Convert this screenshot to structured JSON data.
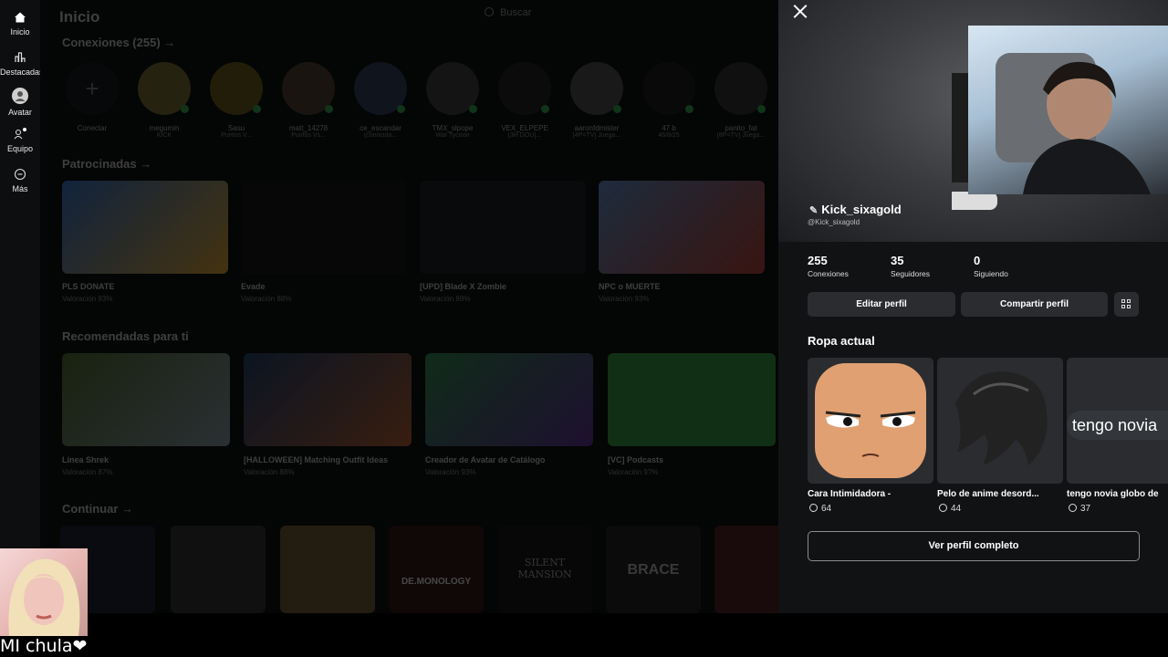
{
  "nav": {
    "items": [
      {
        "label": "Inicio",
        "icon": "home-icon"
      },
      {
        "label": "Destacadas",
        "icon": "chart-icon"
      },
      {
        "label": "Avatar",
        "icon": "avatar-icon"
      },
      {
        "label": "Equipo",
        "icon": "team-icon"
      },
      {
        "label": "Más",
        "icon": "more-icon"
      }
    ]
  },
  "home": {
    "title": "Inicio",
    "search_placeholder": "Buscar",
    "connections_title": "Conexiones (255) →",
    "connections": [
      {
        "name": "Conectar",
        "status": ""
      },
      {
        "name": "megumin",
        "status": "KICK"
      },
      {
        "name": "Sasu",
        "status": "Puntos V..."
      },
      {
        "name": "matt_14278",
        "status": "Puntos Vs..."
      },
      {
        "name": "ce_escandar",
        "status": "(conocida..."
      },
      {
        "name": "TMX_slpope",
        "status": "War Tycoon"
      },
      {
        "name": "VEX_ELPEPE",
        "status": "[3H DOU]..."
      },
      {
        "name": "aaronfdmister",
        "status": "[4P=TV] Juega..."
      },
      {
        "name": "47 b",
        "status": "46/8/25"
      },
      {
        "name": "panito_fat",
        "status": "[8P=TV] Juega..."
      }
    ],
    "sponsored_title": "Patrocinadas →",
    "sponsored": [
      {
        "name": "PLS DONATE",
        "rating": "Valoración 93%"
      },
      {
        "name": "Evade",
        "rating": "Valoración 88%"
      },
      {
        "name": "[UPD] Blade X Zombie",
        "rating": "Valoración 89%"
      },
      {
        "name": "NPC o MUERTE",
        "rating": "Valoración 93%"
      }
    ],
    "recommended_title": "Recomendadas para ti",
    "recommended": [
      {
        "name": "Línea Shrek",
        "rating": "Valoración 87%"
      },
      {
        "name": "[HALLOWEEN] Matching Outfit Ideas",
        "rating": "Valoración 88%"
      },
      {
        "name": "Creador de Avatar de Catálogo",
        "rating": "Valoración 93%"
      },
      {
        "name": "[VC] Podcasts",
        "rating": "Valoración 9?%"
      }
    ],
    "continue_title": "Continuar →",
    "continue_tiles": [
      "",
      "",
      "",
      "DE.MONOLOGY",
      "SILENT MANSION",
      "BRACE",
      ""
    ]
  },
  "profile": {
    "display_name": "Kick_sixagold",
    "handle": "@Kick_sixagold",
    "stats": [
      {
        "value": "255",
        "label": "Conexiones"
      },
      {
        "value": "35",
        "label": "Seguidores"
      },
      {
        "value": "0",
        "label": "Siguiendo"
      }
    ],
    "edit_label": "Editar perfil",
    "share_label": "Compartir perfil",
    "outfit_title": "Ropa actual",
    "items": [
      {
        "name": "Cara Intimidadora -",
        "price": "64"
      },
      {
        "name": "Pelo de anime desord...",
        "price": "44"
      },
      {
        "name": "tengo novia globo de",
        "price": "37",
        "image_text": "tengo novia"
      }
    ],
    "full_profile_label": "Ver perfil completo"
  },
  "overlay": {
    "caption": "MI chula❤"
  },
  "colors": {
    "panel_bg": "#111214",
    "button_bg": "#2a2c30",
    "online": "#3dbb5a"
  }
}
